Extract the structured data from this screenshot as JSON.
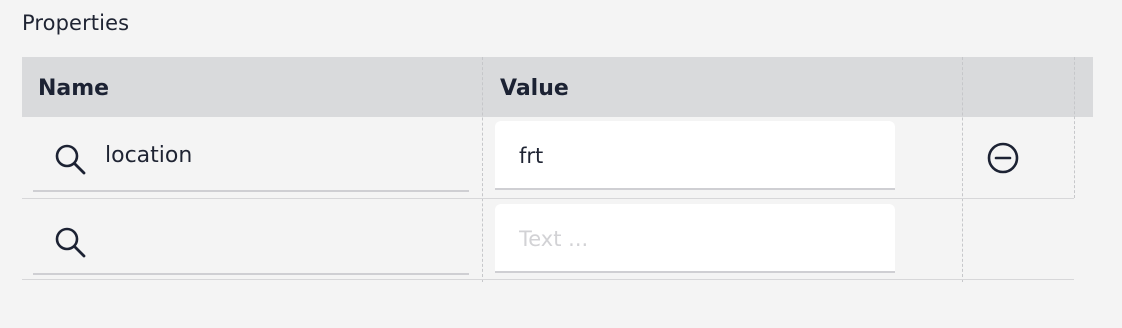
{
  "section": {
    "title": "Properties"
  },
  "table": {
    "columns": {
      "name": "Name",
      "value": "Value"
    },
    "rows": [
      {
        "name": "location",
        "value": "frt",
        "removable": true
      },
      {
        "name": "",
        "value": "",
        "value_placeholder": "Text ...",
        "removable": false
      }
    ]
  },
  "icons": {
    "search": "search-icon",
    "remove": "minus-circle-icon"
  }
}
